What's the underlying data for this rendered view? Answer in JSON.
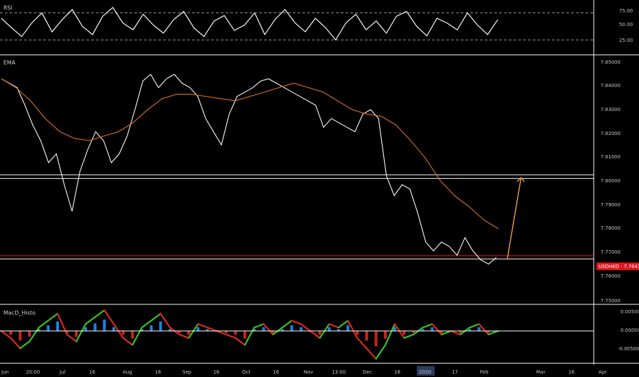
{
  "colors": {
    "background": "#000000",
    "price_line": "#ffffff",
    "ema_line": "#d2691e",
    "pane_separator": "#ffffff",
    "grid": "#3a3a3a",
    "price_tag_bg": "#e0141e",
    "price_tag_text": "#ffffff",
    "red_level": "#e0141e",
    "arrow": "#f5a142",
    "macd_up": "#34c820",
    "macd_down": "#e0281e",
    "macd_hist_pos": "#1e90ff",
    "macd_hist_neg": "#e0281e",
    "year_highlight_bg": "#2a3b5e"
  },
  "panes": {
    "rsi_label": "RSI",
    "ema_label": "EMA",
    "macd_label": "MacD_Histo"
  },
  "rsi_axis": [
    "75.00",
    "50.00",
    "25.00"
  ],
  "price_axis": [
    "7.85000",
    "7.84000",
    "7.83000",
    "7.82000",
    "7.81000",
    "7.80000",
    "7.79000",
    "7.78000",
    "7.77000",
    "7.76000",
    "7.75000"
  ],
  "macd_axis": [
    "0.00500",
    "0.00000",
    "-0.00500"
  ],
  "price_tag": {
    "symbol": "USDHKD",
    "value": "7.76438",
    "text": "USDHKD · 7.76438"
  },
  "time_axis": [
    "Jun",
    "20:00",
    "Jul",
    "16",
    "Aug",
    "16",
    "Sep",
    "16",
    "Oct",
    "16",
    "Nov",
    "13:00",
    "Dec",
    "16",
    "2020",
    "17",
    "Feb",
    "Mar",
    "16",
    "Apr"
  ],
  "highlighted_tick": "2020",
  "chart_data": [
    {
      "type": "line",
      "name": "RSI",
      "ylim": [
        12,
        85
      ],
      "guide_levels": [
        70,
        30
      ],
      "series": [
        {
          "values": [
            62,
            48,
            35,
            55,
            70,
            42,
            60,
            75,
            50,
            38,
            65,
            78,
            55,
            45,
            68,
            52,
            40,
            60,
            72,
            48,
            35,
            58,
            66,
            44,
            52,
            70,
            38,
            60,
            75,
            55,
            42,
            62,
            48,
            30,
            55,
            68,
            45,
            58,
            40,
            65,
            72,
            50,
            36,
            62,
            55,
            45,
            70,
            52,
            38,
            60
          ]
        }
      ]
    },
    {
      "type": "line",
      "name": "USDHKD",
      "ylim": [
        7.745,
        7.855
      ],
      "levels": [
        7.8025,
        7.8008,
        7.7658,
        7.7643
      ],
      "last_price": 7.76438,
      "series": [
        {
          "values": [
            7.846,
            7.844,
            7.842,
            7.834,
            7.825,
            7.818,
            7.808,
            7.812,
            7.798,
            7.786,
            7.804,
            7.814,
            7.822,
            7.818,
            7.808,
            7.812,
            7.82,
            7.832,
            7.845,
            7.848,
            7.842,
            7.846,
            7.848,
            7.844,
            7.842,
            7.838,
            7.828,
            7.822,
            7.816,
            7.83,
            7.838,
            7.84,
            7.842,
            7.845,
            7.846,
            7.844,
            7.842,
            7.84,
            7.838,
            7.836,
            7.834,
            7.824,
            7.828,
            7.826,
            7.824,
            7.822,
            7.83,
            7.832,
            7.828,
            7.802,
            7.793,
            7.798,
            7.796,
            7.785,
            7.772,
            7.768,
            7.772,
            7.77,
            7.766,
            7.774,
            7.768,
            7.764,
            7.762,
            7.765
          ]
        },
        {
          "values": [
            7.846,
            7.842,
            7.836,
            7.828,
            7.822,
            7.819,
            7.818,
            7.82,
            7.822,
            7.826,
            7.832,
            7.837,
            7.839,
            7.839,
            7.838,
            7.837,
            7.836,
            7.838,
            7.84,
            7.842,
            7.844,
            7.842,
            7.84,
            7.836,
            7.832,
            7.83,
            7.829,
            7.825,
            7.818,
            7.81,
            7.8,
            7.793,
            7.788,
            7.782,
            7.778
          ]
        }
      ]
    },
    {
      "type": "line",
      "name": "MacD_Histo",
      "ylim": [
        -0.0085,
        0.0065
      ],
      "zero_line": 0,
      "series": [
        {
          "values": [
            0,
            -0.002,
            -0.005,
            -0.003,
            0.001,
            0.003,
            0.005,
            -0.001,
            -0.003,
            0.002,
            0.004,
            0.006,
            0.002,
            -0.002,
            -0.004,
            0.001,
            0.003,
            0.005,
            0.001,
            -0.001,
            -0.002,
            0.002,
            0.001,
            0.0,
            -0.001,
            -0.002,
            -0.004,
            0.001,
            0.002,
            -0.001,
            0.001,
            0.003,
            0.002,
            0.0,
            -0.002,
            0.002,
            0.001,
            0.003,
            -0.002,
            -0.005,
            -0.008,
            -0.004,
            0.002,
            -0.002,
            -0.001,
            0.001,
            0.002,
            -0.001,
            0.0,
            -0.001,
            0.001,
            0.002,
            -0.001,
            0.0
          ]
        }
      ]
    }
  ]
}
